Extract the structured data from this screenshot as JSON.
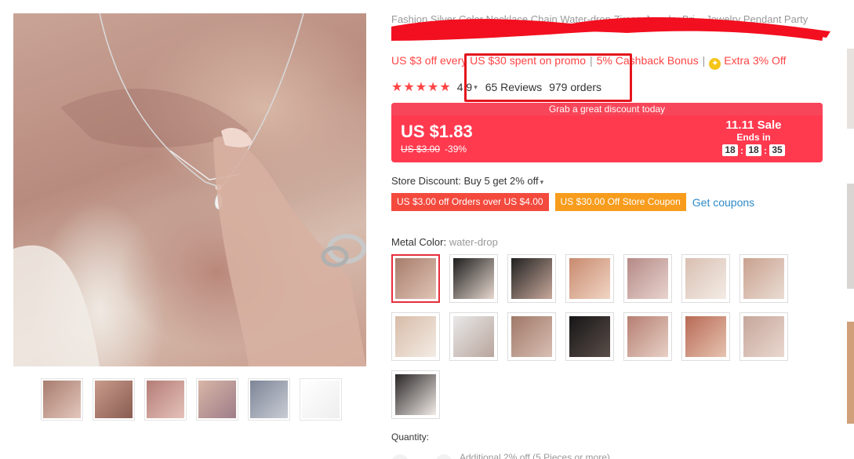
{
  "product": {
    "title": "Fashion Silver Color Necklace Chain Water-drop Zircon Jewelry Bri... Jewelry Pendant Party Wedding"
  },
  "promo": {
    "items": [
      "US $3 off every US $30 spent on promo",
      "5% Cashback Bonus",
      "Extra 3% Off"
    ],
    "coin_glyph": "✦"
  },
  "rating": {
    "stars": "★★★★★",
    "score": "4.9",
    "reviews": "65 Reviews",
    "orders": "979 orders"
  },
  "price": {
    "banner": "Grab a great discount today",
    "current": "US $1.83",
    "original": "US $3.00",
    "discount": "-39%",
    "sale_title": "11.11 Sale",
    "ends_label": "Ends in",
    "timer": [
      "18",
      "18",
      "35"
    ]
  },
  "store": {
    "discount_text": "Store Discount: Buy 5 get 2% off",
    "coupons": [
      "US $3.00 off Orders over US $4.00",
      "US $30.00 Off Store Coupon"
    ],
    "get_coupons": "Get coupons"
  },
  "variant": {
    "label": "Metal Color:",
    "value": "water-drop",
    "swatch_count": 15,
    "selected_index": 0
  },
  "quantity": {
    "label": "Quantity:",
    "note": "Additional 2% off (5 Pieces or more)"
  },
  "colors": {
    "accent_red": "#ff3a4f",
    "promo_red": "#ff4444",
    "coupon_orange": "#f79c1c",
    "link_blue": "#2e8ac7",
    "highlight_red": "#e4151d"
  }
}
